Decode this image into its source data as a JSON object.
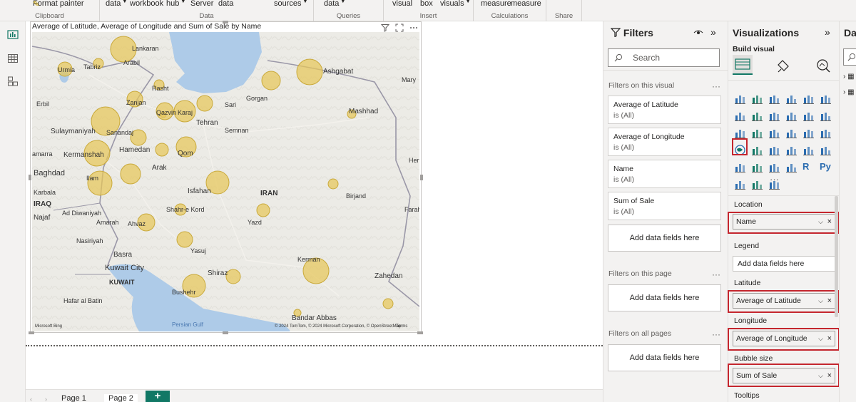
{
  "ribbon": {
    "clipboard": {
      "format_painter": "Format painter",
      "group": "Clipboard"
    },
    "data": {
      "item1": "data",
      "item2": "workbook",
      "item3": "hub",
      "item4": "Server",
      "item5": "data",
      "group": "Data"
    },
    "queries": {
      "item1": "sources",
      "item2": "data",
      "group": "Queries"
    },
    "insert": {
      "item1": "visual",
      "item2": "box",
      "item3": "visuals",
      "group": "Insert"
    },
    "calculations": {
      "item1": "measure",
      "item2": "measure",
      "group": "Calculations"
    },
    "share": {
      "group": "Share"
    }
  },
  "visual": {
    "title": "Average of Latitude, Average of Longitude and Sum of Sale by Name",
    "bubble_color": "#e6c65a",
    "map_labels": {
      "ankaran": "Lankaran",
      "ardabil": "Ardabil",
      "urmia": "Urmia",
      "tabriz": "Tabriz",
      "rasht": "Rasht",
      "ashgabat": "Ashgabat",
      "mary": "Mary",
      "erbil": "Erbil",
      "zanjan": "Zanjan",
      "gorgan": "Gorgan",
      "sari": "Sari",
      "qazvin": "Qazvin",
      "karaj": "Karaj",
      "tehran": "Tehran",
      "mashhad": "Mashhad",
      "sulaymaniyah": "Sulaymaniyah",
      "sanandaj": "Sanandaj",
      "semnan": "Semnan",
      "hamedan": "Hamedan",
      "kermanshah": "Kermanshah",
      "samarra": "amarra",
      "qom": "Qom",
      "arak": "Arak",
      "baghdad": "Baghdad",
      "herat": "Her",
      "karbala": "Karbala",
      "iraq": "IRAQ",
      "ilam": "Ilam",
      "isfahan": "Isfahan",
      "iran": "IRAN",
      "birjand": "Birjand",
      "najaf": "Najaf",
      "diwaniyah": "Ad Diwaniyah",
      "shahrekord": "Shahr-e Kord",
      "farah": "Farah",
      "amarah": "Amarah",
      "ahvaz": "Ahvaz",
      "yazd": "Yazd",
      "nasiriyah": "Nasiriyah",
      "yasuj": "Yasuj",
      "basra": "Basra",
      "kerman": "Kerman",
      "kuwaitcity": "Kuwait City",
      "kuwait": "KUWAIT",
      "shiraz": "Shiraz",
      "zahedan": "Zahedan",
      "bushehr": "Bushehr",
      "hafar": "Hafar al Batin",
      "bandarabbas": "Bandar Abbas",
      "persiangulf": "Persian Gulf",
      "bing": "Microsoft Bing",
      "copyright": "© 2024 TomTom, © 2024 Microsoft Corporation, © OpenStreetMap",
      "terms": "Terms",
      "arabil": "Arabil"
    }
  },
  "pages": {
    "tab1": "Page 1",
    "tab2": "Page 2",
    "add": "+"
  },
  "filters": {
    "title": "Filters",
    "search_placeholder": "Search",
    "on_visual": "Filters on this visual",
    "cards": [
      {
        "field": "Average of Latitude",
        "state": "is (All)"
      },
      {
        "field": "Average of Longitude",
        "state": "is (All)"
      },
      {
        "field": "Name",
        "state": "is (All)"
      },
      {
        "field": "Sum of Sale",
        "state": "is (All)"
      }
    ],
    "add_fields": "Add data fields here",
    "on_page": "Filters on this page",
    "on_all": "Filters on all pages",
    "more": "···"
  },
  "visualizations": {
    "title": "Visualizations",
    "build_visual": "Build visual",
    "more": "···",
    "wells": {
      "location": "Location",
      "location_value": "Name",
      "legend": "Legend",
      "legend_placeholder": "Add data fields here",
      "latitude": "Latitude",
      "latitude_value": "Average of Latitude",
      "longitude": "Longitude",
      "longitude_value": "Average of Longitude",
      "bubble": "Bubble size",
      "bubble_value": "Sum of Sale",
      "tooltips": "Tooltips"
    },
    "highlight_color": "#c4262e"
  },
  "data_pane": {
    "title": "Da"
  },
  "accent": "#117865"
}
